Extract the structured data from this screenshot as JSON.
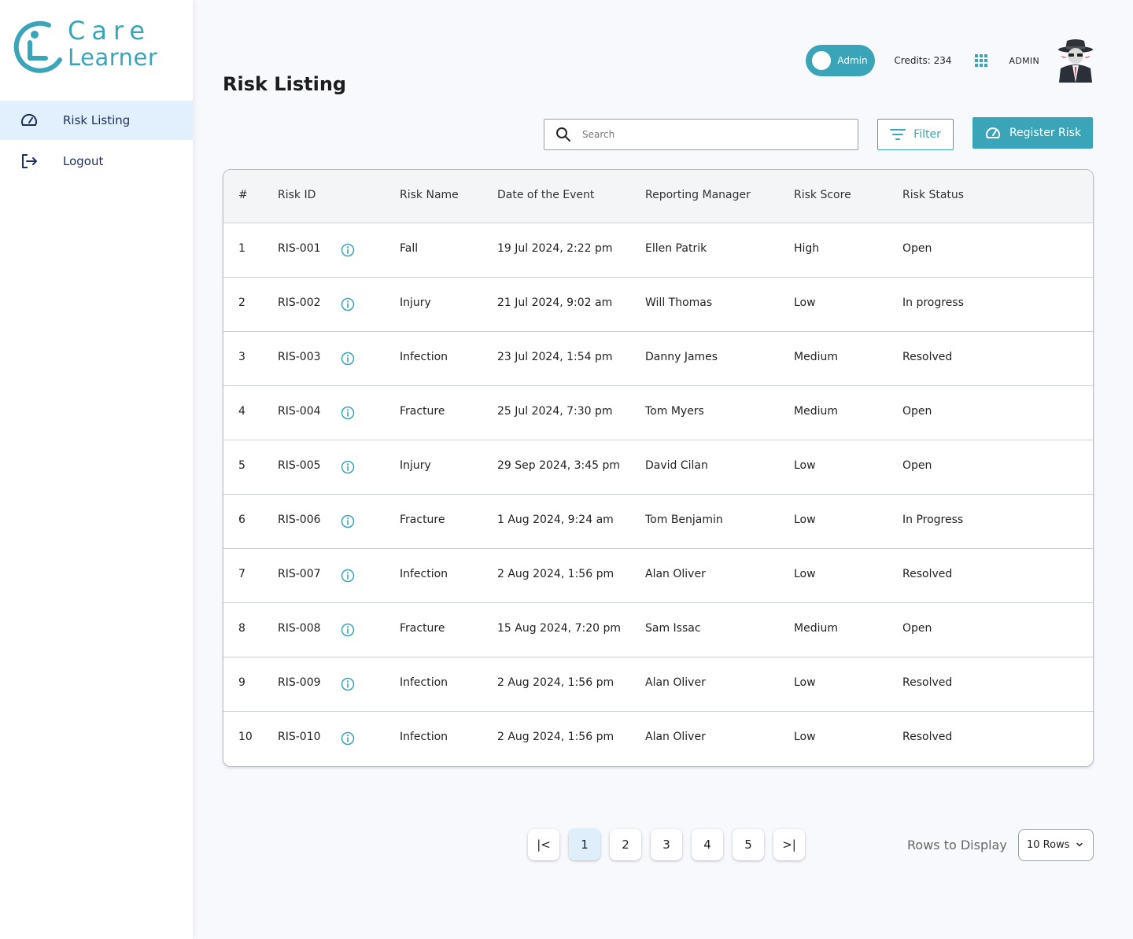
{
  "brand": {
    "line1": "Care",
    "line2": "Learner",
    "color": "#3aa5b8"
  },
  "sidebar": {
    "items": [
      {
        "label": "Risk Listing",
        "icon": "dashboard-icon",
        "active": true
      },
      {
        "label": "Logout",
        "icon": "logout-icon",
        "active": false
      }
    ]
  },
  "page": {
    "title": "Risk Listing"
  },
  "header": {
    "toggle_label": "Admin",
    "credits": "Credits: 234",
    "user_name": "ADMIN"
  },
  "toolbar": {
    "search_placeholder": "Search",
    "filter_label": "Filter",
    "register_label": "Register Risk"
  },
  "table": {
    "headers": [
      "#",
      "Risk ID",
      "Risk Name",
      "Date of the Event",
      "Reporting Manager",
      "Risk Score",
      "Risk Status"
    ],
    "rows": [
      {
        "num": "1",
        "id": "RIS-001",
        "name": "Fall",
        "date": "19 Jul 2024, 2:22 pm",
        "manager": "Ellen Patrik",
        "score": "High",
        "status": "Open"
      },
      {
        "num": "2",
        "id": "RIS-002",
        "name": "Injury",
        "date": "21 Jul 2024, 9:02 am",
        "manager": "Will Thomas",
        "score": "Low",
        "status": "In progress"
      },
      {
        "num": "3",
        "id": "RIS-003",
        "name": "Infection",
        "date": "23 Jul 2024, 1:54 pm",
        "manager": "Danny James",
        "score": "Medium",
        "status": "Resolved"
      },
      {
        "num": "4",
        "id": "RIS-004",
        "name": "Fracture",
        "date": "25 Jul 2024, 7:30 pm",
        "manager": "Tom Myers",
        "score": "Medium",
        "status": "Open"
      },
      {
        "num": "5",
        "id": "RIS-005",
        "name": "Injury",
        "date": "29 Sep 2024, 3:45 pm",
        "manager": "David Cilan",
        "score": "Low",
        "status": "Open"
      },
      {
        "num": "6",
        "id": "RIS-006",
        "name": "Fracture",
        "date": "1 Aug 2024, 9:24 am",
        "manager": "Tom Benjamin",
        "score": "Low",
        "status": "In Progress"
      },
      {
        "num": "7",
        "id": "RIS-007",
        "name": "Infection",
        "date": "2 Aug 2024, 1:56 pm",
        "manager": "Alan Oliver",
        "score": "Low",
        "status": "Resolved"
      },
      {
        "num": "8",
        "id": "RIS-008",
        "name": "Fracture",
        "date": "15 Aug 2024, 7:20 pm",
        "manager": "Sam Issac",
        "score": "Medium",
        "status": "Open"
      },
      {
        "num": "9",
        "id": "RIS-009",
        "name": "Infection",
        "date": "2 Aug 2024, 1:56 pm",
        "manager": "Alan Oliver",
        "score": "Low",
        "status": "Resolved"
      },
      {
        "num": "10",
        "id": "RIS-010",
        "name": "Infection",
        "date": "2 Aug 2024, 1:56 pm",
        "manager": "Alan Oliver",
        "score": "Low",
        "status": "Resolved"
      }
    ]
  },
  "pagination": {
    "first_symbol": "|<",
    "last_symbol": ">|",
    "pages": [
      "1",
      "2",
      "3",
      "4",
      "5"
    ],
    "current": "1",
    "rows_label": "Rows to Display",
    "rows_value": "10 Rows"
  }
}
